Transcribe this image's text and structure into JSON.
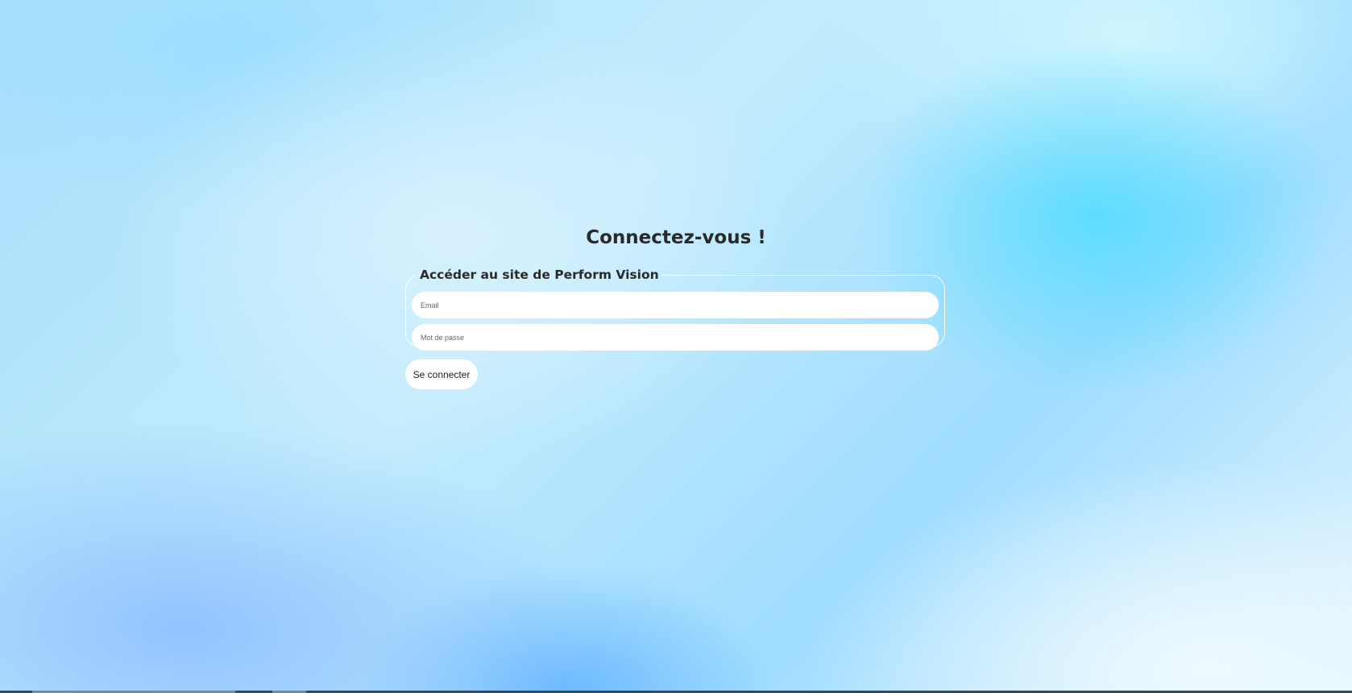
{
  "page": {
    "title": "Connectez-vous !"
  },
  "login_form": {
    "legend": "Accéder au site de Perform Vision",
    "email": {
      "placeholder": "Email",
      "value": ""
    },
    "password": {
      "placeholder": "Mot de passe",
      "value": ""
    },
    "submit_label": "Se connecter"
  },
  "colors": {
    "title_text": "#2a2a2a",
    "field_background": "#ffffff",
    "background_accent": "#50dcff"
  }
}
